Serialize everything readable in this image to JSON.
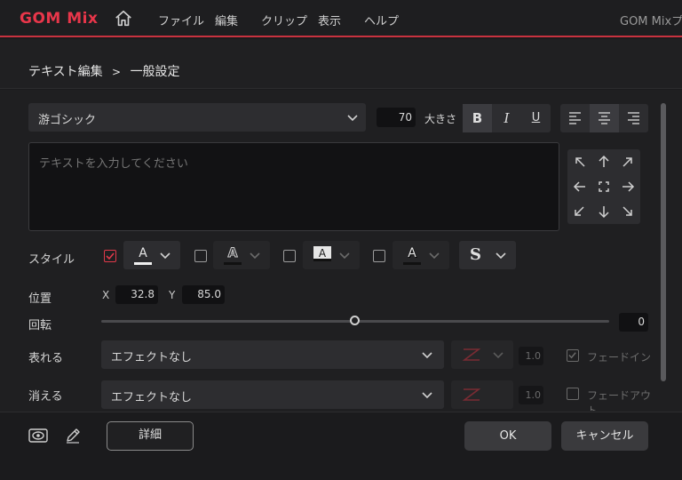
{
  "app": {
    "logo": "GOM Mix",
    "window_title": "GOM Mixプ"
  },
  "menu": {
    "file": "ファイル",
    "edit": "編集",
    "clip": "クリップ",
    "view": "表示",
    "help": "ヘルプ"
  },
  "breadcrumb": {
    "parent": "テキスト編集",
    "separator": ">",
    "current": "一般設定"
  },
  "font": {
    "name": "游ゴシック",
    "size": "70",
    "size_label": "大きさ"
  },
  "format": {
    "bold": "B",
    "italic": "I",
    "underline": "U"
  },
  "text": {
    "placeholder": "テキストを入力してください"
  },
  "style": {
    "label": "スタイル",
    "glyph": "A",
    "shadow_glyph": "S",
    "accent_color": "#e0394a",
    "options": [
      {
        "checked": true
      },
      {
        "checked": false
      },
      {
        "checked": false
      },
      {
        "checked": false
      }
    ]
  },
  "position": {
    "label": "位置",
    "x_label": "X",
    "x_value": "32.8",
    "y_label": "Y",
    "y_value": "85.0"
  },
  "rotation": {
    "label": "回転",
    "value": "0",
    "slider_fraction": 0.5
  },
  "appear": {
    "label": "表れる",
    "effect": "エフェクトなし",
    "duration": "1.0",
    "fade_label": "フェードイン"
  },
  "disappear": {
    "label": "消える",
    "effect": "エフェクトなし",
    "duration": "1.0",
    "fade_label": "フェードアウト"
  },
  "footer": {
    "detail": "詳細",
    "ok": "OK",
    "cancel": "キャンセル"
  }
}
